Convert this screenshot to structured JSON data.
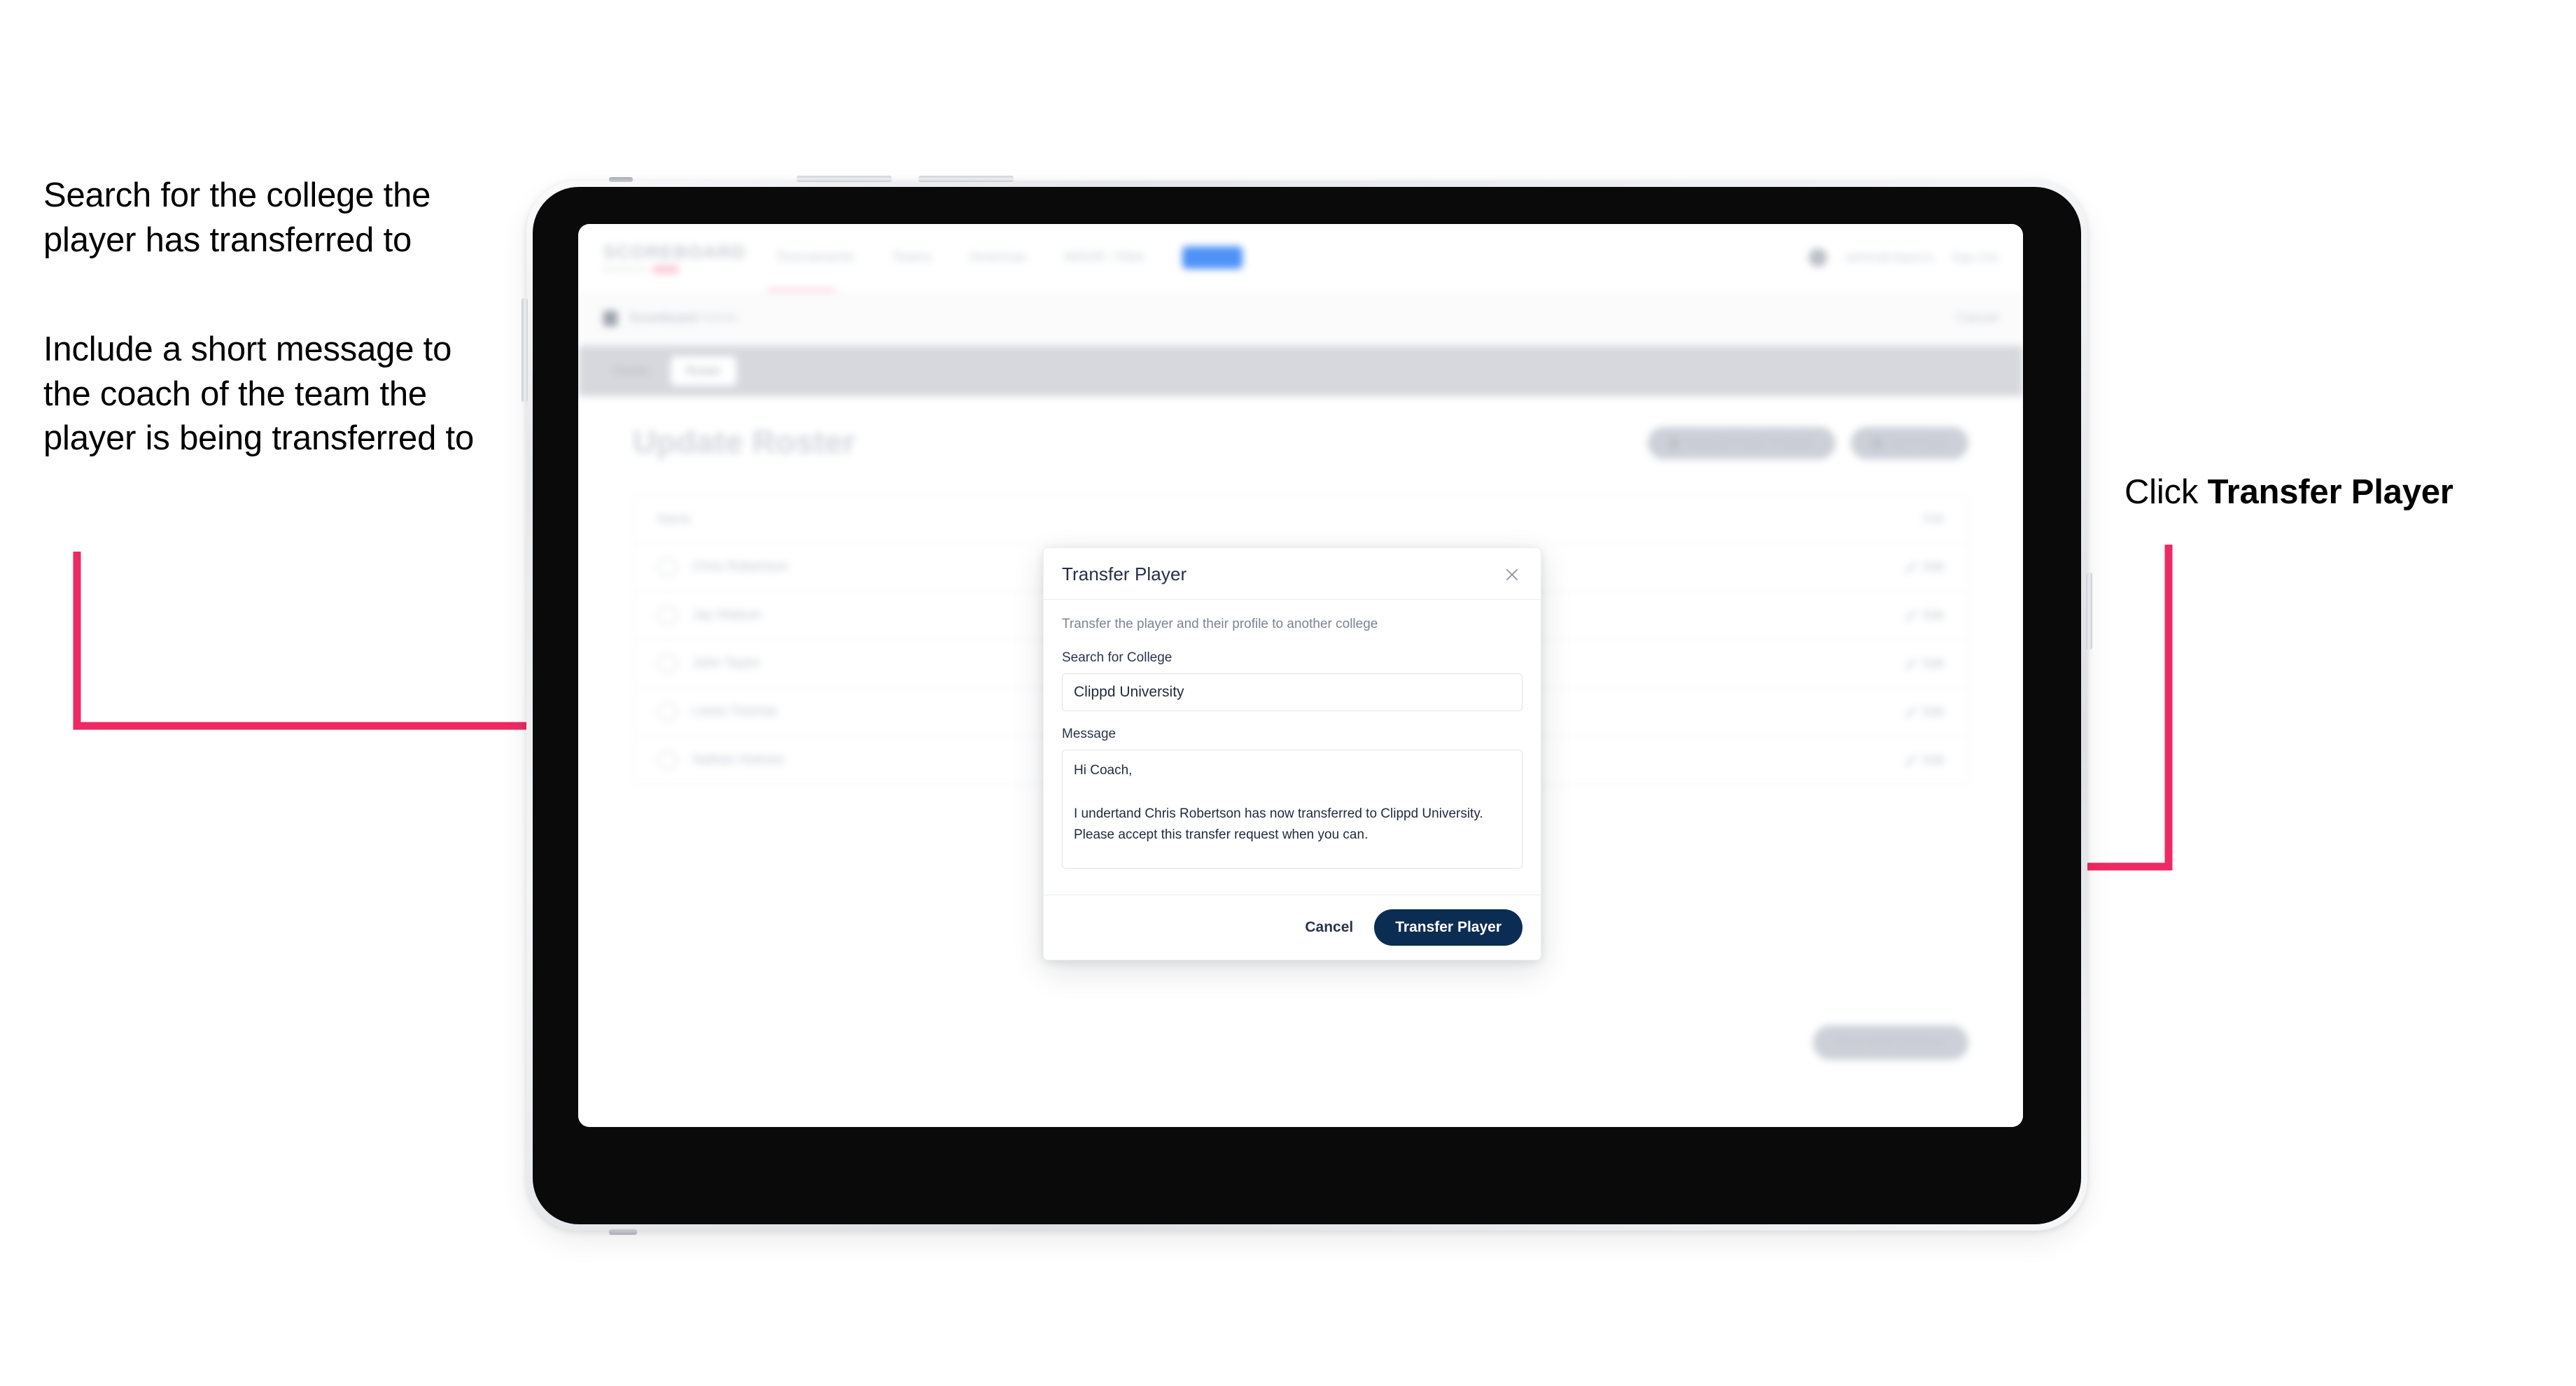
{
  "annotations": {
    "left_1": "Search for the college the player has transferred to",
    "left_2": "Include a short message to the coach of the team the player is being transferred to",
    "right_prefix": "Click ",
    "right_bold": "Transfer Player"
  },
  "colors": {
    "arrow": "#ED2A63",
    "primary_button": "#0C2D53",
    "modal_title": "#243046"
  },
  "app": {
    "logo": {
      "main": "SCOREBOARD",
      "sub": "powered by",
      "sub_badge": "clippd"
    },
    "nav": [
      {
        "label": "Tournaments"
      },
      {
        "label": "Teams"
      },
      {
        "label": "Americas"
      },
      {
        "label": "WAGR / R&A"
      },
      {
        "label": "Admin"
      }
    ],
    "nav_right": {
      "email": "admin@clippd.io",
      "sign_out": "Sign Out"
    },
    "breadcrumb": {
      "title": "Scoreboard",
      "subtitle": "Admin",
      "right": "Cancel"
    },
    "tabs": [
      {
        "label": "Details",
        "active": false
      },
      {
        "label": "Roster",
        "active": true
      }
    ],
    "page_title": "Update Roster",
    "page_actions": [
      {
        "label": "Request Player Transfer"
      },
      {
        "label": "Add Player"
      }
    ],
    "roster": {
      "header_label": "Name",
      "header_right": "Edit",
      "rows": [
        {
          "name": "Chris Robertson",
          "action": "Edit"
        },
        {
          "name": "Jay Watson",
          "action": "Edit"
        },
        {
          "name": "John Taylor",
          "action": "Edit"
        },
        {
          "name": "Lewis Thomas",
          "action": "Edit"
        },
        {
          "name": "Nathan Holmes",
          "action": "Edit"
        }
      ]
    },
    "bottom_action": "Save And Continue"
  },
  "modal": {
    "title": "Transfer Player",
    "close_icon": "close-icon",
    "description": "Transfer the player and their profile to another college",
    "search_label": "Search for College",
    "search_value": "Clippd University",
    "search_placeholder": "Search for College",
    "message_label": "Message",
    "message_value": "Hi Coach,\n\nI undertand Chris Robertson has now transferred to Clippd University. Please accept this transfer request when you can.",
    "message_placeholder": "Message",
    "cancel_label": "Cancel",
    "submit_label": "Transfer Player"
  }
}
